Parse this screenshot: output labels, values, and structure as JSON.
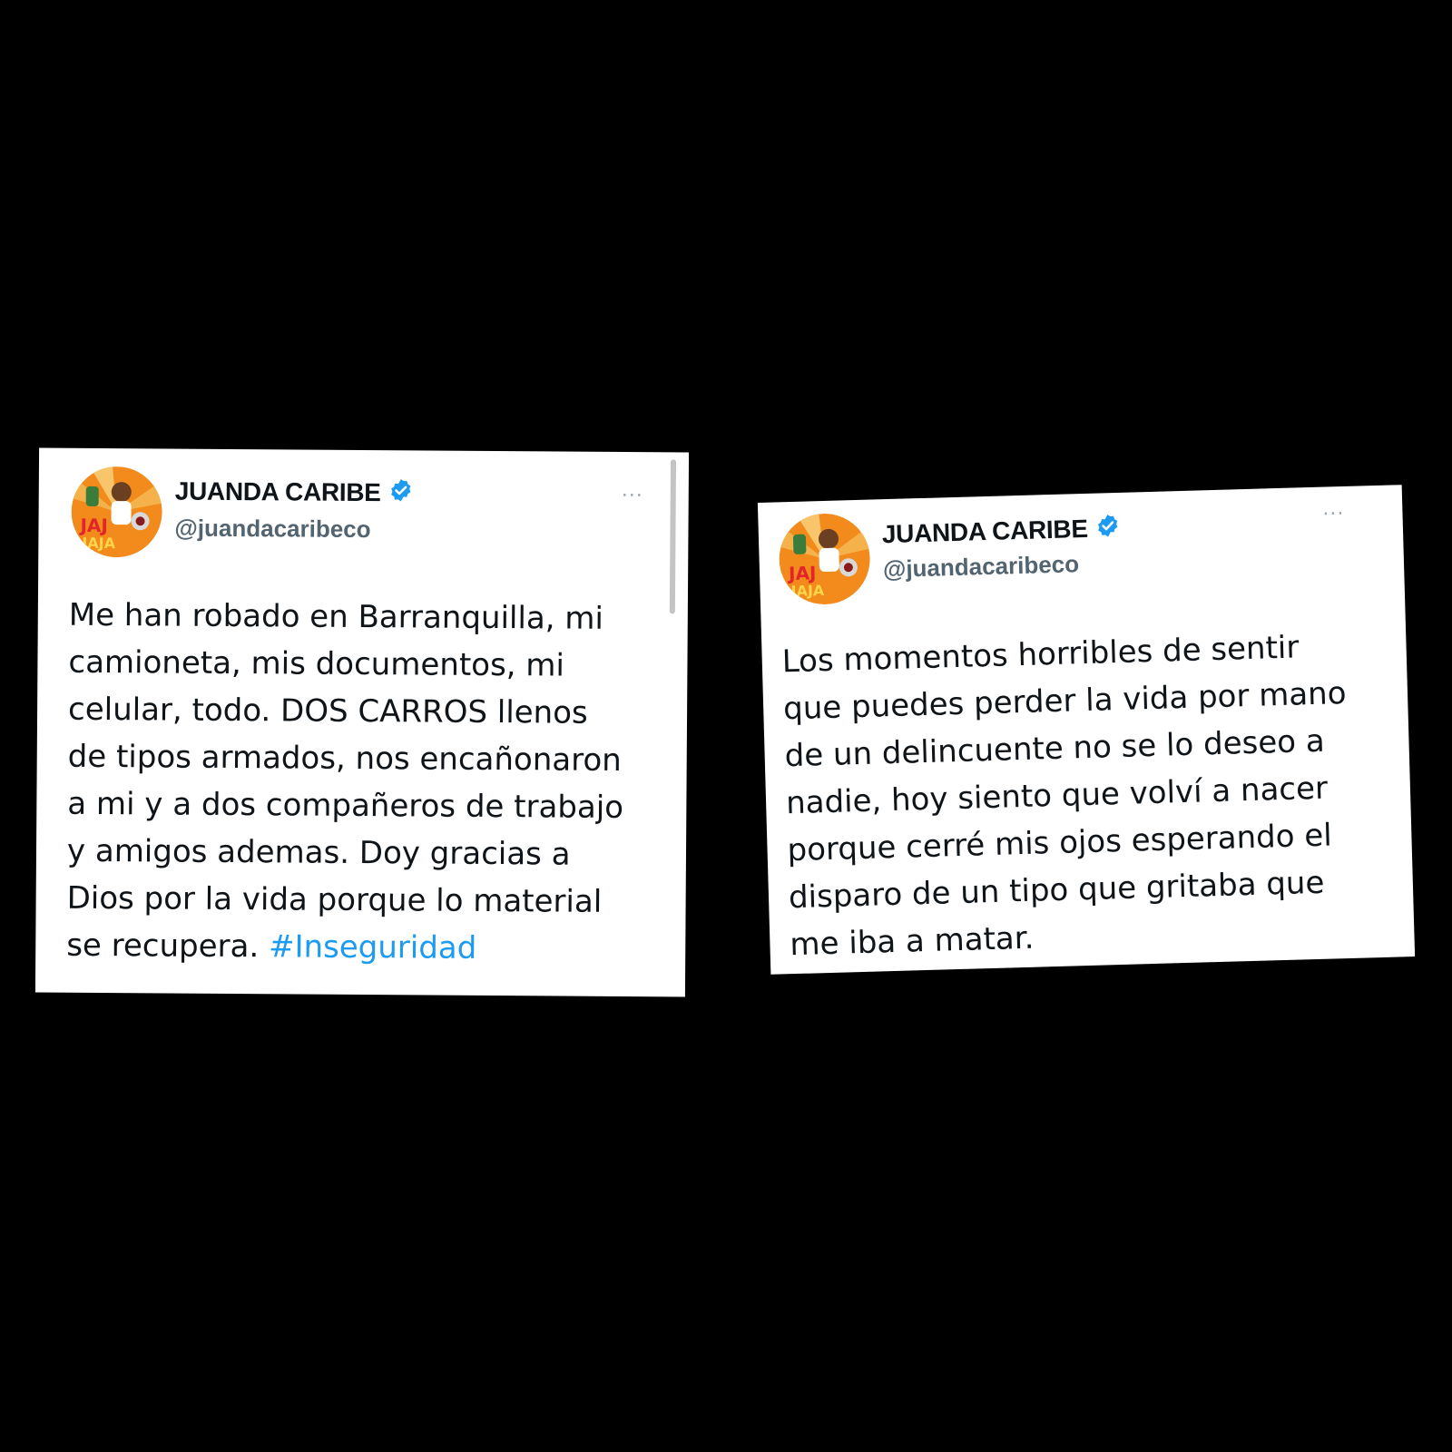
{
  "tweets": [
    {
      "display_name": "JUANDA CARIBE",
      "handle": "@juandacaribeco",
      "verified_icon": "verified-badge-icon",
      "more_label": "···",
      "text": "Me han robado en Barranquilla, mi\ncamioneta, mis documentos, mi\ncelular, todo. DOS CARROS llenos\nde tipos armados, nos encañonaron\na mi y a dos compañeros de trabajo\ny amigos ademas. Doy gracias a\nDios por la vida porque lo material\nse recupera. ",
      "hashtag": "#Inseguridad"
    },
    {
      "display_name": "JUANDA CARIBE",
      "handle": "@juandacaribeco",
      "verified_icon": "verified-badge-icon",
      "more_label": "···",
      "text": "Los momentos horribles de sentir\nque puedes perder la vida por mano\nde un delincuente no se lo deseo a\nnadie, hoy siento que volví a nacer\nporque cerré mis ojos esperando el\ndisparo de un tipo que gritaba que\nme iba a matar."
    }
  ],
  "colors": {
    "background": "#000000",
    "card": "#ffffff",
    "text": "#0f1419",
    "handle": "#536471",
    "hashtag": "#1d9bf0",
    "verified": "#1d9bf0",
    "avatar_orange": "#f28a1c"
  }
}
